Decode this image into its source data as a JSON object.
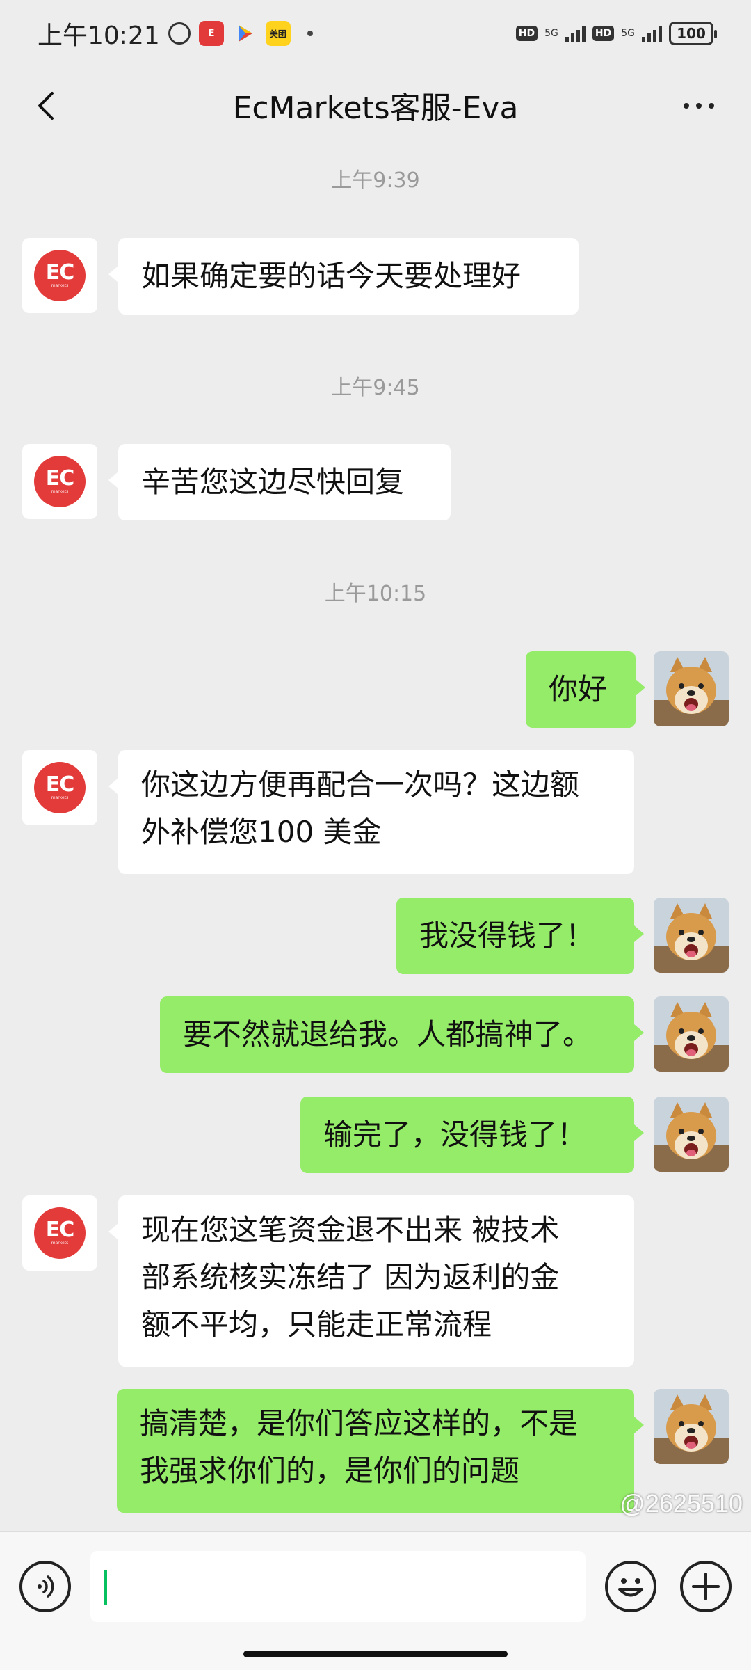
{
  "status_bar": {
    "time": "上午10:21",
    "app_icon_red": "E",
    "app_icon_yellow": "美团",
    "network_1": "5G",
    "network_2": "5G",
    "hd_1": "HD",
    "hd_2": "HD",
    "battery": "100"
  },
  "header": {
    "title": "EcMarkets客服-Eva"
  },
  "avatar_logo": {
    "text": "EC",
    "sub": "markets"
  },
  "messages": [
    {
      "type": "time",
      "text": "上午9:39"
    },
    {
      "type": "in",
      "text": "如果确定要的话今天要处理好"
    },
    {
      "type": "time",
      "text": "上午9:45"
    },
    {
      "type": "in",
      "text": "辛苦您这边尽快回复"
    },
    {
      "type": "time",
      "text": "上午10:15"
    },
    {
      "type": "out",
      "text": "你好"
    },
    {
      "type": "in",
      "lines": [
        "你这边方便再配合一次吗？这边额",
        "外补偿您100 美金"
      ]
    },
    {
      "type": "out",
      "text": "我没得钱了！"
    },
    {
      "type": "out",
      "text": "要不然就退给我。人都搞神了。"
    },
    {
      "type": "out",
      "text": "输完了，没得钱了！"
    },
    {
      "type": "in",
      "lines": [
        "现在您这笔资金退不出来 被技术",
        "部系统核实冻结了 因为返利的金",
        "额不平均，只能走正常流程"
      ]
    },
    {
      "type": "out",
      "lines": [
        "搞清楚，是你们答应这样的，不是",
        "我强求你们的，是你们的问题"
      ]
    }
  ],
  "input": {
    "value": ""
  },
  "watermark": "@2625510",
  "colors": {
    "background": "#ededed",
    "outgoing_bubble": "#95ec69",
    "incoming_bubble": "#ffffff",
    "ec_red": "#e33a3a",
    "cursor": "#07c160"
  }
}
